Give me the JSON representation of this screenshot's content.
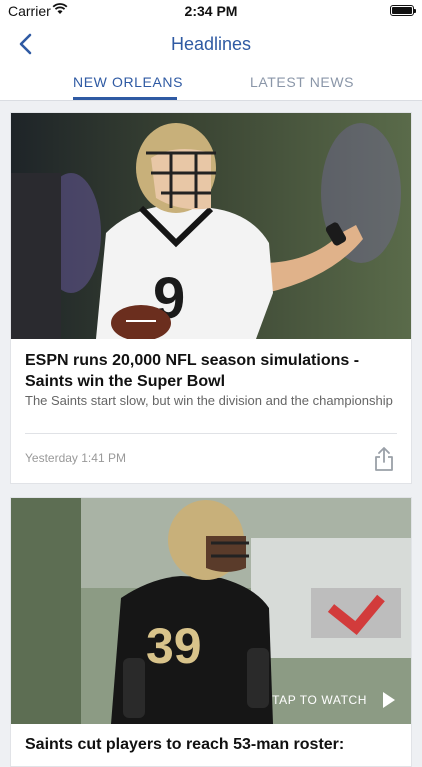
{
  "status": {
    "carrier": "Carrier",
    "time": "2:34 PM"
  },
  "nav": {
    "title": "Headlines",
    "back_icon": "chevron-left-icon"
  },
  "tabs": [
    {
      "label": "NEW ORLEANS",
      "active": true
    },
    {
      "label": "LATEST NEWS",
      "active": false
    }
  ],
  "colors": {
    "accent": "#2f5aa3",
    "inactive_tab": "#8a96a8",
    "background": "#eef0f3"
  },
  "articles": [
    {
      "title": "ESPN runs 20,000 NFL season simulations - Saints win the Super Bowl",
      "summary": "The Saints start slow, but win the division and the championship",
      "timestamp": "Yesterday 1:41 PM",
      "share_icon": "share-icon",
      "image": {
        "jersey_number": "9"
      }
    },
    {
      "title": "Saints cut players to reach 53-man roster:",
      "video_label": "TAP TO WATCH",
      "play_icon": "play-icon",
      "image": {
        "jersey_number": "39"
      }
    }
  ]
}
